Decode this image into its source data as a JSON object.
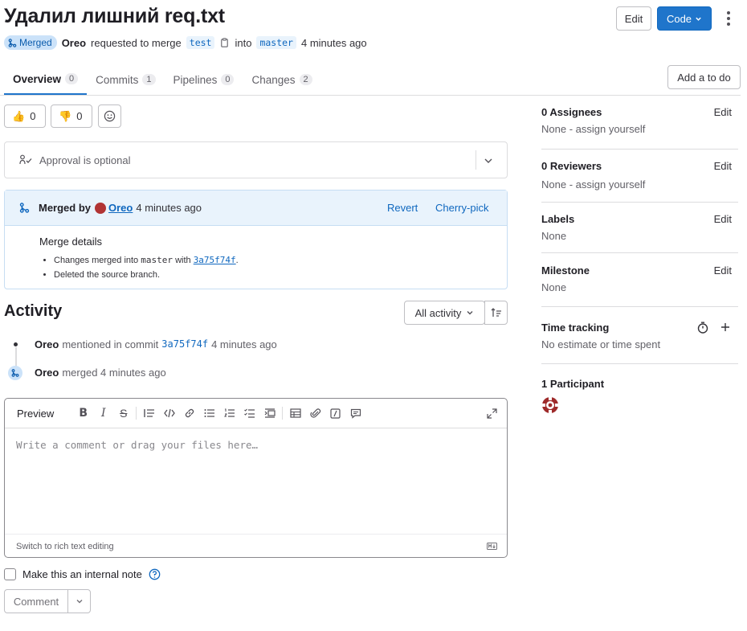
{
  "header": {
    "title": "Удалил лишний req.txt",
    "edit_label": "Edit",
    "code_label": "Code"
  },
  "meta": {
    "status": "Merged",
    "author": "Oreo",
    "requested_text": "requested to merge",
    "source_branch": "test",
    "into_text": "into",
    "target_branch": "master",
    "time": "4 minutes ago"
  },
  "tabs": [
    {
      "label": "Overview",
      "count": "0"
    },
    {
      "label": "Commits",
      "count": "1"
    },
    {
      "label": "Pipelines",
      "count": "0"
    },
    {
      "label": "Changes",
      "count": "2"
    }
  ],
  "todo_label": "Add a to do",
  "reactions": {
    "thumbs_up": "👍",
    "thumbs_up_count": "0",
    "thumbs_down": "👎",
    "thumbs_down_count": "0"
  },
  "approval": {
    "text": "Approval is optional"
  },
  "merged_widget": {
    "merged_by_text": "Merged by",
    "user": "Oreo",
    "time": "4 minutes ago",
    "revert_label": "Revert",
    "cherry_pick_label": "Cherry-pick",
    "details_title": "Merge details",
    "line1_prefix": "Changes merged into",
    "line1_branch": "master",
    "line1_with": "with",
    "line1_commit": "3a75f74f",
    "line1_suffix": ".",
    "line2": "Deleted the source branch."
  },
  "sidebar": {
    "assignees": {
      "title": "0 Assignees",
      "value": "None - assign yourself",
      "edit": "Edit"
    },
    "reviewers": {
      "title": "0 Reviewers",
      "value": "None - assign yourself",
      "edit": "Edit"
    },
    "labels": {
      "title": "Labels",
      "value": "None",
      "edit": "Edit"
    },
    "milestone": {
      "title": "Milestone",
      "value": "None",
      "edit": "Edit"
    },
    "time_tracking": {
      "title": "Time tracking",
      "value": "No estimate or time spent"
    },
    "participants": {
      "title": "1 Participant"
    }
  },
  "activity": {
    "title": "Activity",
    "filter_label": "All activity",
    "items": [
      {
        "user": "Oreo",
        "text": "mentioned in commit",
        "commit": "3a75f74f",
        "time": "4 minutes ago"
      },
      {
        "user": "Oreo",
        "text": "merged 4 minutes ago"
      }
    ]
  },
  "editor": {
    "preview_label": "Preview",
    "placeholder": "Write a comment or drag your files here…",
    "switch_label": "Switch to rich text editing"
  },
  "internal_note_label": "Make this an internal note",
  "comment_label": "Comment",
  "colors": {
    "primary": "#1f75cb",
    "merged_badge_bg": "#cbe2f9",
    "merged_badge_text": "#0b5cad",
    "link": "#1068bf"
  }
}
